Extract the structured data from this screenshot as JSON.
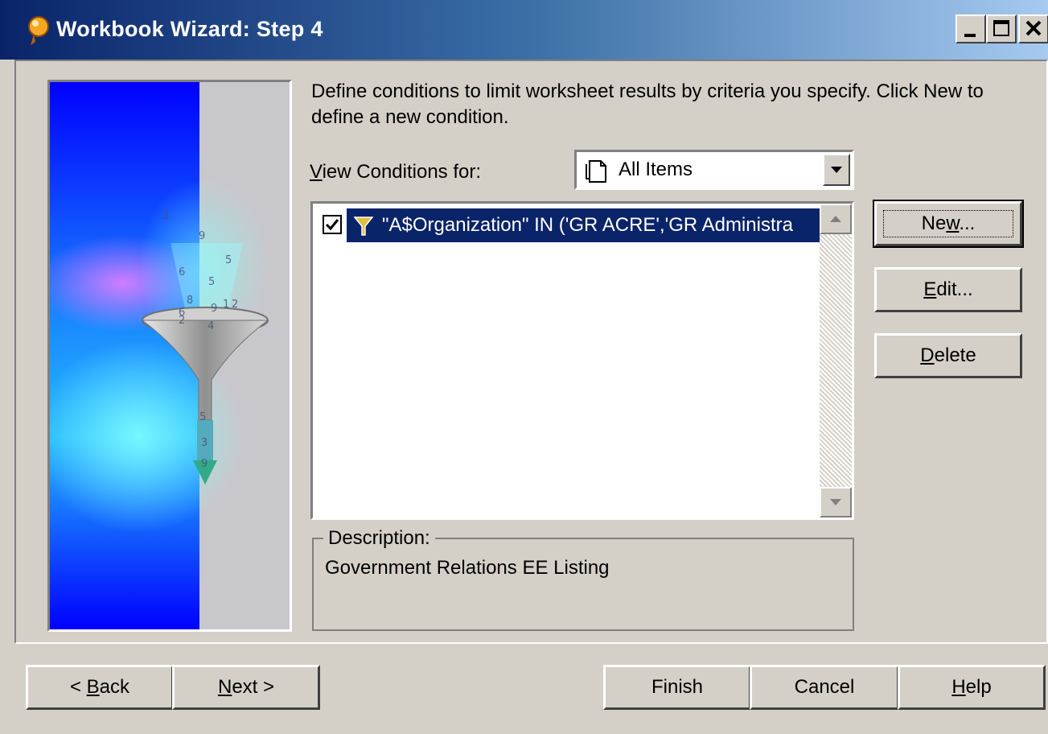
{
  "window": {
    "title": "Workbook Wizard: Step 4",
    "controls": [
      "minimize",
      "maximize",
      "close"
    ]
  },
  "instructions": "Define conditions to limit worksheet results by criteria you specify. Click New to define a new condition.",
  "view_conditions": {
    "label_prefix": "V",
    "label_rest": "iew Conditions for:",
    "selected": "All Items",
    "icon": "document-icon"
  },
  "conditions": [
    {
      "checked": true,
      "text": "\"A$Organization\" IN ('GR ACRE','GR Administra",
      "icon": "funnel-icon"
    }
  ],
  "side_buttons": {
    "new": {
      "pre": "Ne",
      "acc": "w",
      "post": "..."
    },
    "edit": {
      "pre": "",
      "acc": "E",
      "post": "dit..."
    },
    "delete": {
      "pre": "",
      "acc": "D",
      "post": "elete"
    }
  },
  "description": {
    "label": "Description:",
    "text": "Government Relations EE Listing"
  },
  "bottom_buttons": {
    "back": {
      "pre": "< ",
      "acc": "B",
      "post": "ack"
    },
    "next": {
      "pre": "",
      "acc": "N",
      "post": "ext >"
    },
    "finish": "Finish",
    "cancel": "Cancel",
    "help": {
      "pre": "",
      "acc": "H",
      "post": "elp"
    }
  },
  "illustration_digits": [
    "3",
    "9",
    "5",
    "6",
    "5",
    "8",
    "2",
    "9",
    "1",
    "2",
    "4",
    "6",
    "5",
    "3",
    "9"
  ],
  "colors": {
    "titlebar_start": "#0a246a",
    "titlebar_end": "#a6caf0",
    "selection": "#0a246a",
    "face": "#d4d0c8"
  }
}
